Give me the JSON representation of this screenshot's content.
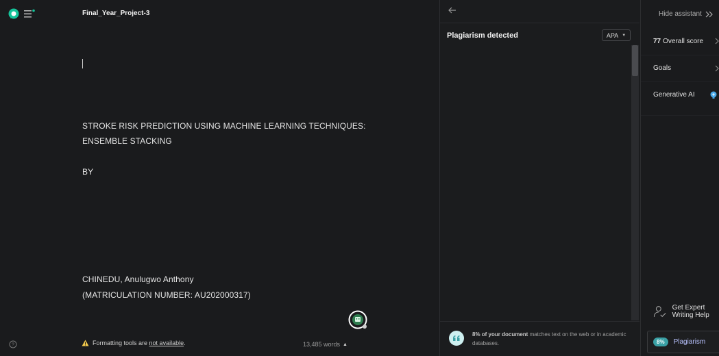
{
  "document": {
    "title": "Final_Year_Project-3",
    "lines": [
      "STROKE RISK PREDICTION USING MACHINE LEARNING TECHNIQUES:",
      "ENSEMBLE STACKING",
      "BY",
      "CHINEDU, Anulugwo Anthony",
      "(MATRICULATION NUMBER: AU202000317)"
    ]
  },
  "status_bar": {
    "warning_prefix": "Formatting tools are ",
    "warning_emph": "not available",
    "warning_suffix": ".",
    "word_count": "13,485 words"
  },
  "plagiarism_panel": {
    "title": "Plagiarism detected",
    "citation_style": "APA",
    "summary_bold": "8% of your document",
    "summary_rest": " matches text on the web or in academic databases."
  },
  "assistant": {
    "hide_label": "Hide assistant",
    "score_value": "77",
    "score_label": "Overall score",
    "goals_label": "Goals",
    "genai_label": "Generative AI",
    "expert_label": "Get Expert Writing Help",
    "plagiarism_percent": "8%",
    "plagiarism_label": "Plagiarism"
  },
  "colors": {
    "background": "#1a1b1d",
    "accent_teal": "#3aa0a5",
    "badge_green": "#15c39a",
    "link_lavender": "#b9c3ff"
  }
}
